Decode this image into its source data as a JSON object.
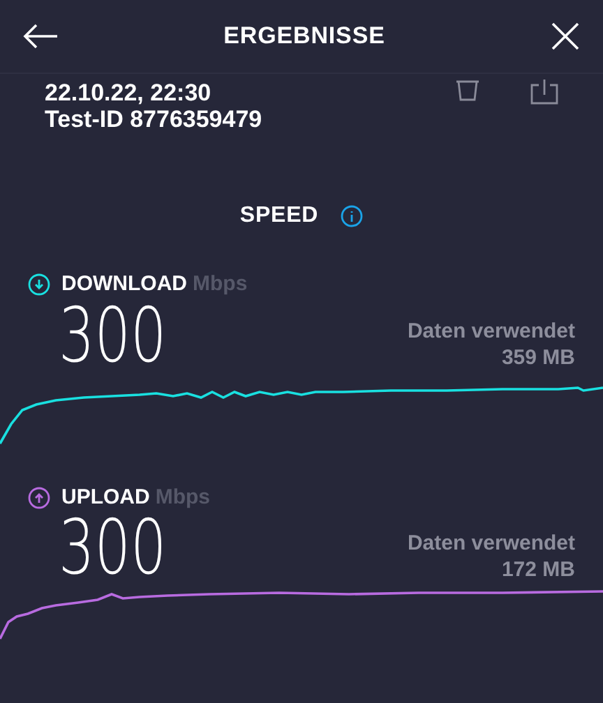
{
  "header": {
    "title": "ERGEBNISSE"
  },
  "meta": {
    "date": "22.10.22, 22:30",
    "test_id": "Test-ID 8776359479"
  },
  "section": {
    "title": "SPEED"
  },
  "tests": [
    {
      "kind": "download",
      "label": "DOWNLOAD",
      "unit": "Mbps",
      "value": "300",
      "data_label": "Daten verwendet",
      "data_value": "359 MB",
      "color": "#19e0e0"
    },
    {
      "kind": "upload",
      "label": "UPLOAD",
      "unit": "Mbps",
      "value": "300",
      "data_label": "Daten verwendet",
      "data_value": "172 MB",
      "color": "#b86be0"
    }
  ]
}
